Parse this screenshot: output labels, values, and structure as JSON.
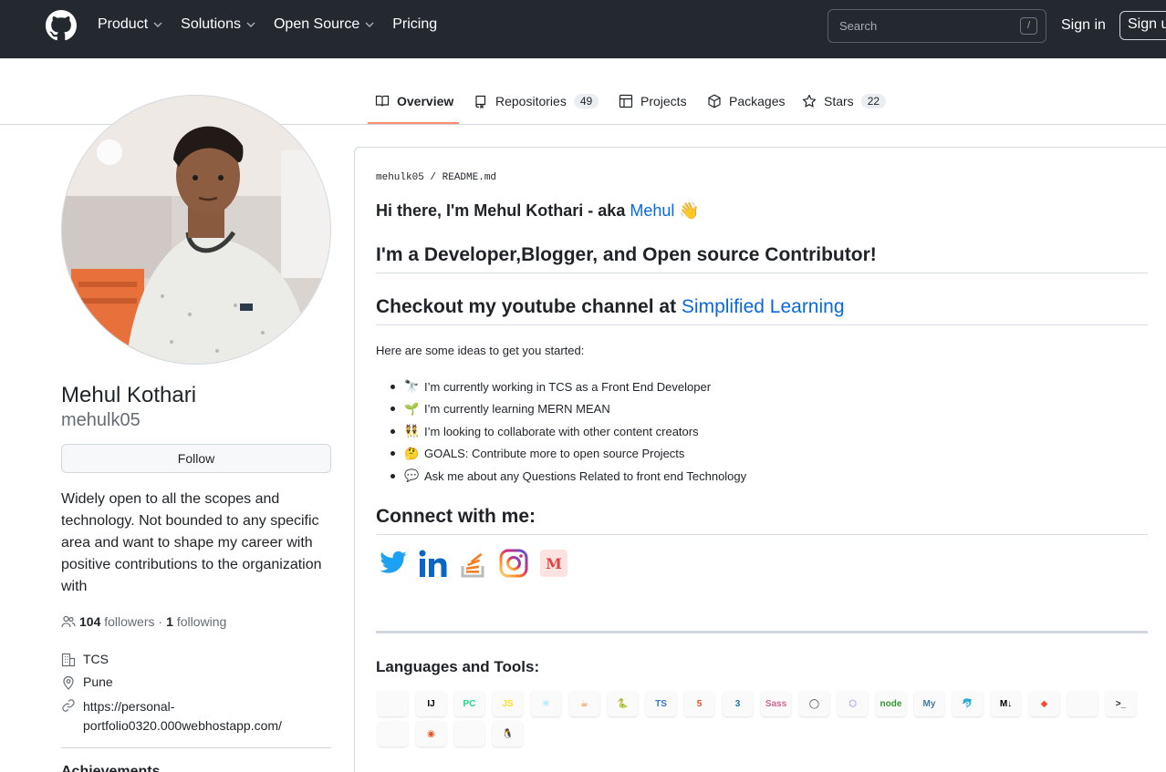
{
  "header": {
    "nav": [
      {
        "label": "Product",
        "dropdown": true
      },
      {
        "label": "Solutions",
        "dropdown": true
      },
      {
        "label": "Open Source",
        "dropdown": true
      },
      {
        "label": "Pricing",
        "dropdown": false
      }
    ],
    "search_placeholder": "Search",
    "search_key": "/",
    "sign_in": "Sign in",
    "sign_up": "Sign up"
  },
  "tabs": [
    {
      "label": "Overview",
      "icon": "book-icon",
      "selected": true
    },
    {
      "label": "Repositories",
      "icon": "repo-icon",
      "count": "49"
    },
    {
      "label": "Projects",
      "icon": "table-icon"
    },
    {
      "label": "Packages",
      "icon": "package-icon"
    },
    {
      "label": "Stars",
      "icon": "star-icon",
      "count": "22"
    }
  ],
  "profile": {
    "name": "Mehul Kothari",
    "login": "mehulk05",
    "follow_label": "Follow",
    "bio": "Widely open to all the scopes and technology. Not bounded to any specific area and want to shape my career with positive contributions to the organization with",
    "followers_count": "104",
    "followers_label": "followers",
    "following_count": "1",
    "following_label": "following",
    "company": "TCS",
    "location": "Pune",
    "website": "https://personal-portfolio0320.000webhostapp.com/",
    "achievements_label": "Achievements"
  },
  "readme": {
    "path": "mehulk05 / README.md",
    "greeting_prefix": "Hi there, I'm Mehul Kothari - aka ",
    "greeting_link": "Mehul",
    "greeting_emoji": "👋",
    "heading_dev": "I'm a Developer,Blogger, and Open source Contributor!",
    "heading_youtube_prefix": "Checkout my youtube channel at ",
    "heading_youtube_link": "Simplified Learning",
    "intro": "Here are some ideas to get you started:",
    "ideas": [
      {
        "emoji": "🔭",
        "text": "I’m currently working in TCS as a Front End Developer"
      },
      {
        "emoji": "🌱",
        "text": "I’m currently learning MERN MEAN"
      },
      {
        "emoji": "👯",
        "text": "I’m looking to collaborate with other content creators"
      },
      {
        "emoji": "🤔",
        "text": "GOALS: Contribute more to open source Projects"
      },
      {
        "emoji": "💬",
        "text": "Ask me about any Questions Related to front end Technology"
      }
    ],
    "connect_heading": "Connect with me:",
    "social": [
      "twitter-icon",
      "linkedin-icon",
      "stackoverflow-icon",
      "instagram-icon",
      "medium-icon"
    ],
    "languages_heading": "Languages and Tools:",
    "tools": [
      {
        "name": "vscode-icon",
        "glyph": "",
        "color": "#0078d4"
      },
      {
        "name": "intellij-icon",
        "glyph": "IJ",
        "color": "#000000"
      },
      {
        "name": "pycharm-icon",
        "glyph": "PC",
        "color": "#21d789"
      },
      {
        "name": "javascript-icon",
        "glyph": "JS",
        "color": "#f7df1e"
      },
      {
        "name": "react-icon",
        "glyph": "⚛",
        "color": "#61dafb"
      },
      {
        "name": "java-icon",
        "glyph": "☕",
        "color": "#e76f00"
      },
      {
        "name": "python-icon",
        "glyph": "🐍",
        "color": "#3776ab"
      },
      {
        "name": "typescript-icon",
        "glyph": "TS",
        "color": "#3178c6"
      },
      {
        "name": "html5-icon",
        "glyph": "5",
        "color": "#e34f26"
      },
      {
        "name": "css3-icon",
        "glyph": "3",
        "color": "#1572b6"
      },
      {
        "name": "sass-icon",
        "glyph": "Sass",
        "color": "#cc6699"
      },
      {
        "name": "ionic-icon",
        "glyph": "◯",
        "color": "#333333"
      },
      {
        "name": "webpack-icon",
        "glyph": "⬡",
        "color": "#8d6cf0"
      },
      {
        "name": "nodejs-icon",
        "glyph": "node",
        "color": "#339933"
      },
      {
        "name": "mysql-icon",
        "glyph": "My",
        "color": "#4479a1"
      },
      {
        "name": "mariadb-icon",
        "glyph": "🐬",
        "color": "#009688"
      },
      {
        "name": "markdown-icon",
        "glyph": "M↓",
        "color": "#000000"
      },
      {
        "name": "git-icon",
        "glyph": "◆",
        "color": "#f05032"
      },
      {
        "name": "github-icon",
        "glyph": "",
        "color": "#24292f"
      },
      {
        "name": "terminal-icon",
        "glyph": ">_",
        "color": "#24292f"
      },
      {
        "name": "windows-icon",
        "glyph": "",
        "color": "#0078d4"
      },
      {
        "name": "ubuntu-icon",
        "glyph": "◉",
        "color": "#e95420"
      },
      {
        "name": "macos-finder-icon",
        "glyph": "",
        "color": "#6ea8e8"
      },
      {
        "name": "linux-icon",
        "glyph": "🐧",
        "color": "#333333"
      }
    ]
  },
  "colors": {
    "header_bg": "#24292f",
    "link": "#0969da",
    "tab_underline": "#fd8c73",
    "border": "#d0d7de"
  }
}
